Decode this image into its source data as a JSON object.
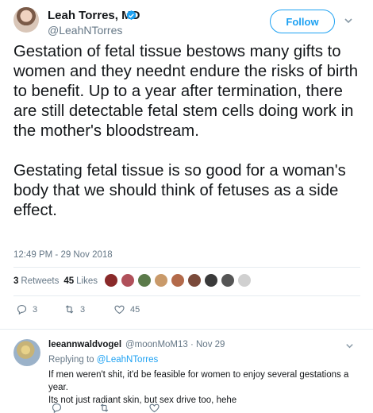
{
  "author": {
    "display_name": "Leah Torres, MD",
    "handle": "@LeahNTorres",
    "verified": true
  },
  "follow_label": "Follow",
  "tweet_text": "Gestation of fetal tissue bestows many gifts to women and they neednt endure the risks of birth to benefit. Up to a year after termination, there are still detectable fetal stem cells doing work in the mother's bloodstream.\n\nGestating fetal tissue is so good for a woman's body that we should think of fetuses as a side effect.",
  "timestamp": "12:49 PM - 29 Nov 2018",
  "stats": {
    "retweets_count": "3",
    "retweets_label": "Retweets",
    "likes_count": "45",
    "likes_label": "Likes"
  },
  "actions": {
    "replies": "3",
    "retweets": "3",
    "likes": "45"
  },
  "liker_colors": [
    "#8a2a2a",
    "#b0505a",
    "#5b7a4a",
    "#c99a6a",
    "#b36a4a",
    "#7a4a3a",
    "#3a3a3a",
    "#555555",
    "#d0d0d0"
  ],
  "reply": {
    "name": "leeannwaldvogel",
    "meta": "@moonMoM13 · Nov 29",
    "replying_prefix": "Replying to",
    "replying_handle": "@LeahNTorres",
    "text": "If men weren't shit, it'd be feasible for women to enjoy several gestations a year.\nIts not just radiant skin, but sex drive too, hehe"
  },
  "colors": {
    "accent": "#1da1f2",
    "muted": "#657786",
    "text": "#14171a"
  }
}
